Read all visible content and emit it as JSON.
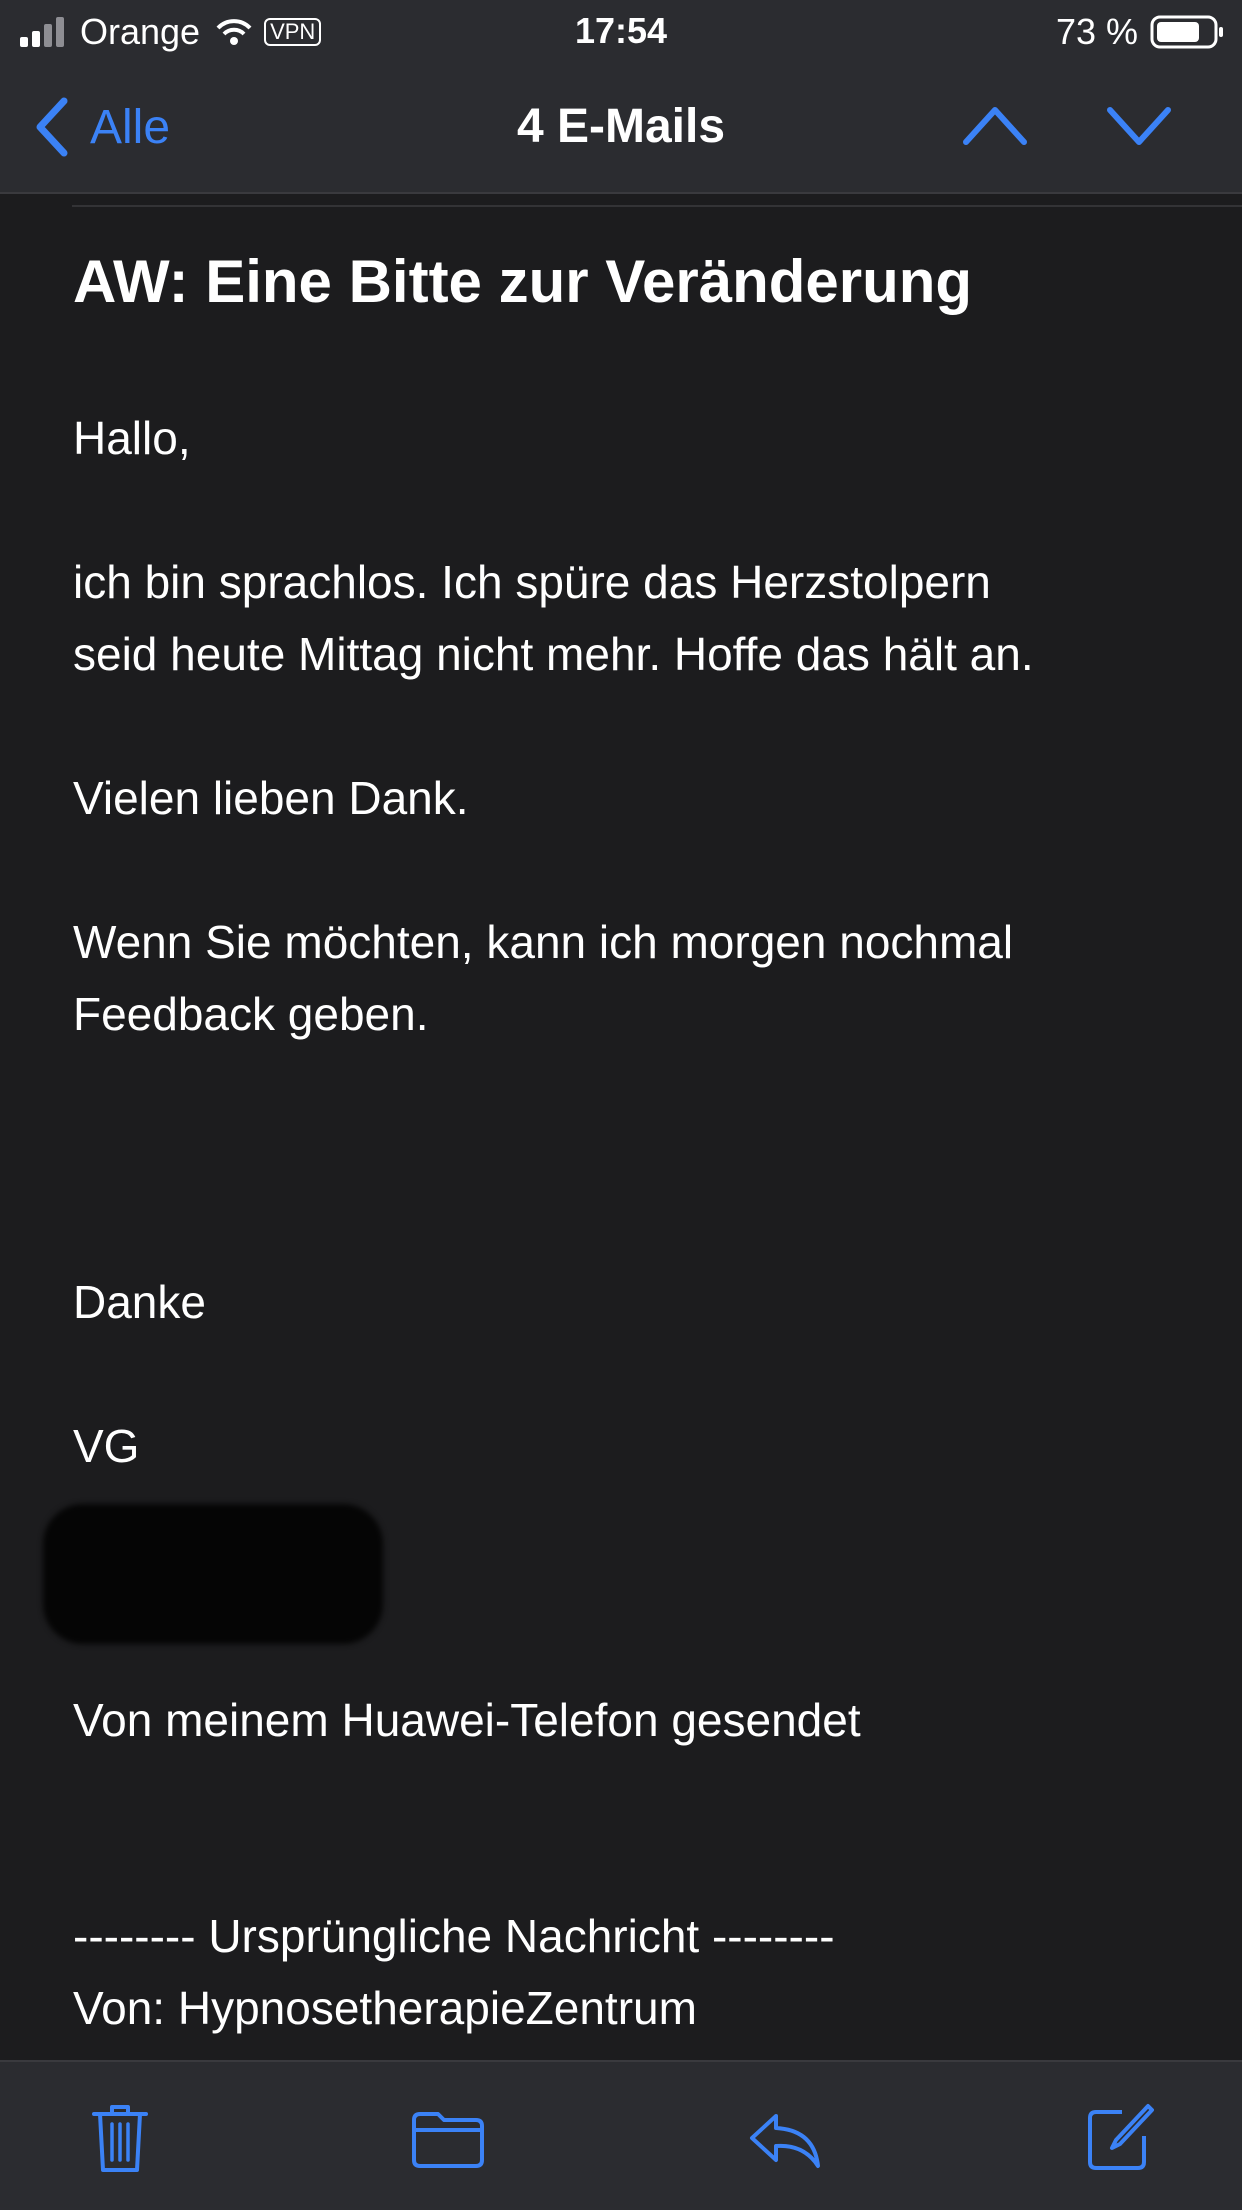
{
  "status": {
    "carrier": "Orange",
    "vpn": "VPN",
    "time": "17:54",
    "battery": "73 %"
  },
  "nav": {
    "back_label": "Alle",
    "title": "4 E-Mails"
  },
  "email": {
    "subject": "AW: Eine Bitte zur Veränderung",
    "greeting": "Hallo,",
    "body_line1": "ich bin sprachlos. Ich spüre das Herzstolpern",
    "body_line2": "seid heute Mittag nicht mehr. Hoffe das hält an.",
    "thanks": "Vielen lieben Dank.",
    "feedback_line1": "Wenn Sie möchten, kann ich morgen nochmal",
    "feedback_line2": "Feedback geben.",
    "closing": "Danke",
    "sign": "VG",
    "signature_footer": "Von meinem Huawei-Telefon gesendet",
    "original_header": "-------- Ursprüngliche Nachricht --------",
    "original_from": "Von: HypnosetherapieZentrum"
  },
  "toolbar": {
    "icons": [
      "trash-icon",
      "folder-icon",
      "reply-icon",
      "compose-icon"
    ]
  },
  "colors": {
    "accent": "#3b82f6",
    "background": "#1c1c1e",
    "bar": "#2b2c30"
  }
}
